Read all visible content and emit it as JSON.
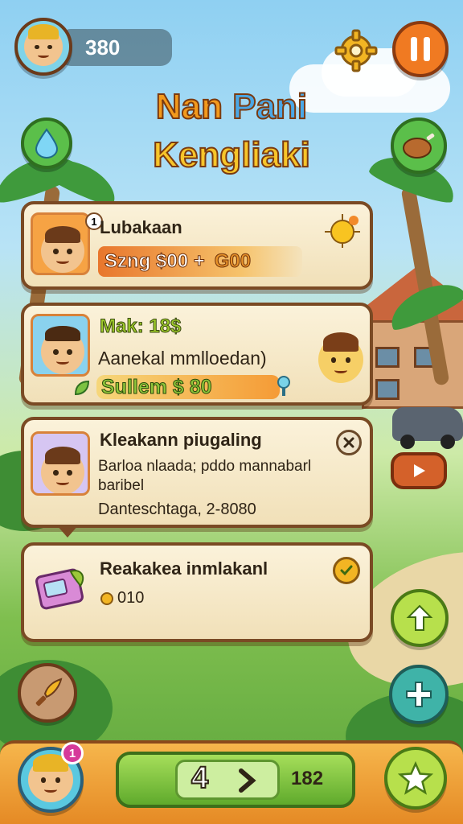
{
  "header": {
    "coins": "380",
    "settings_icon": "gear-icon",
    "pause_icon": "pause-icon"
  },
  "title": {
    "line1_a": "Nan",
    "line1_b": "Pani",
    "line2": "Kengliaki"
  },
  "cards": [
    {
      "title": "Lubakaan",
      "reward": "Szng $00 +",
      "reward_extra": "G00",
      "badge": "1"
    },
    {
      "title": "Mak: 18$",
      "subtitle": "Aanekal mmlloedan)",
      "bar_text": "Sullem $ 80"
    },
    {
      "title": "Kleakann piugaling",
      "body": "Barloa nlaada; pddo mannabarl baribel",
      "date": "Danteschtaga, 2-8080"
    },
    {
      "title": "Reakakea inmlakanl",
      "amount": "010"
    }
  ],
  "bottom": {
    "notification_count": "1",
    "stage_current": "4",
    "stage_total": "182"
  },
  "colors": {
    "accent_orange": "#f08a24",
    "green": "#7cc242",
    "wood": "#7a4a24",
    "parchment": "#f7ebcb"
  }
}
